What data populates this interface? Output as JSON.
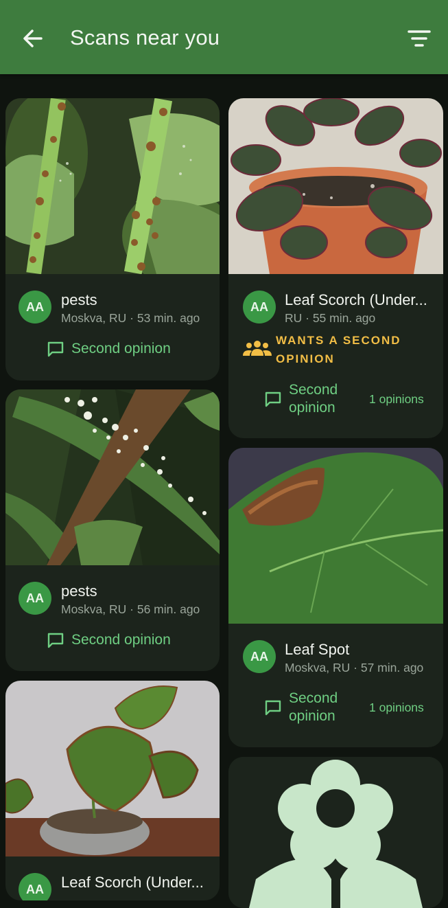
{
  "appbar": {
    "title": "Scans near you",
    "back_icon": "arrow-back-icon",
    "filter_icon": "filter-list-icon",
    "color": "#3e7c3e"
  },
  "cards": [
    {
      "avatar": "AA",
      "title": "pests",
      "meta": "Moskva, RU · 53 min. ago",
      "action": "Second opinion"
    },
    {
      "avatar": "AA",
      "title": "Leaf Scorch (Under...",
      "meta": "RU · 55 min. ago",
      "wants_line1": "WANTS A SECOND",
      "wants_line2": "OPINION",
      "action_line1": "Second",
      "action_line2": "opinion",
      "opinions": "1 opinions"
    },
    {
      "avatar": "AA",
      "title": "pests",
      "meta": "Moskva, RU · 56 min. ago",
      "action": "Second opinion"
    },
    {
      "avatar": "AA",
      "title": "Leaf Spot",
      "meta": "Moskva, RU · 57 min. ago",
      "action_line1": "Second",
      "action_line2": "opinion",
      "opinions": "1 opinions"
    },
    {
      "avatar": "AA",
      "title": "Leaf Scorch (Under..."
    },
    {
      "placeholder_icon": "flower-icon"
    }
  ],
  "colors": {
    "accent_green": "#6fcf83",
    "avatar_green": "#3a9845",
    "warning_yellow": "#f2be46",
    "card_bg": "#1c241c"
  }
}
